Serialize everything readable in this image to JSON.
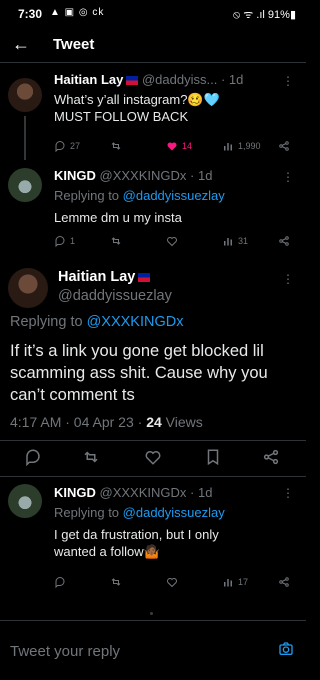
{
  "status_bar": {
    "time": "7:30",
    "left_icons": "▲ ▣ ◎ ck",
    "right": "⦸ ᯤ .ıl 91%▮"
  },
  "header": {
    "title": "Tweet"
  },
  "tweets": [
    {
      "name": "Haitian Lay",
      "handle": "@daddyiss...",
      "time": "· 1d",
      "text_line1": "What’s y’all instagram?🥴🩵",
      "text_line2": "MUST FOLLOW BACK",
      "replies": "27",
      "retweets": "",
      "likes": "14",
      "views": "1,990"
    },
    {
      "name": "KINGD",
      "handle": "@XXXKINGDx",
      "time": "· 1d",
      "reply_prefix": "Replying to ",
      "reply_handle": "@daddyissuezlay",
      "text_line1": "Lemme dm u my insta",
      "replies": "1",
      "retweets": "",
      "likes": "",
      "views": "31"
    }
  ],
  "main_tweet": {
    "name": "Haitian Lay",
    "handle": "@daddyissuezlay",
    "reply_prefix": "Replying to ",
    "reply_handle": "@XXXKINGDx",
    "text": "If it’s a link you gone get blocked lil scamming ass shit. Cause why you can’t comment ts",
    "time": "4:17 AM · 04 Apr 23 · ",
    "views_count": "24",
    "views_label": " Views"
  },
  "reply_tweet": {
    "name": "KINGD",
    "handle": "@XXXKINGDx",
    "time": "· 1d",
    "reply_prefix": "Replying to ",
    "reply_handle": "@daddyissuezlay",
    "text_line1": "I get da frustration, but I only",
    "text_line2": "wanted a follow🤷🏾",
    "views": "17"
  },
  "reply_bar": {
    "placeholder": "Tweet your reply"
  },
  "colors": {
    "background": "#000000",
    "accent": "#1d9bf0",
    "like": "#f91880",
    "muted": "#71767b"
  }
}
